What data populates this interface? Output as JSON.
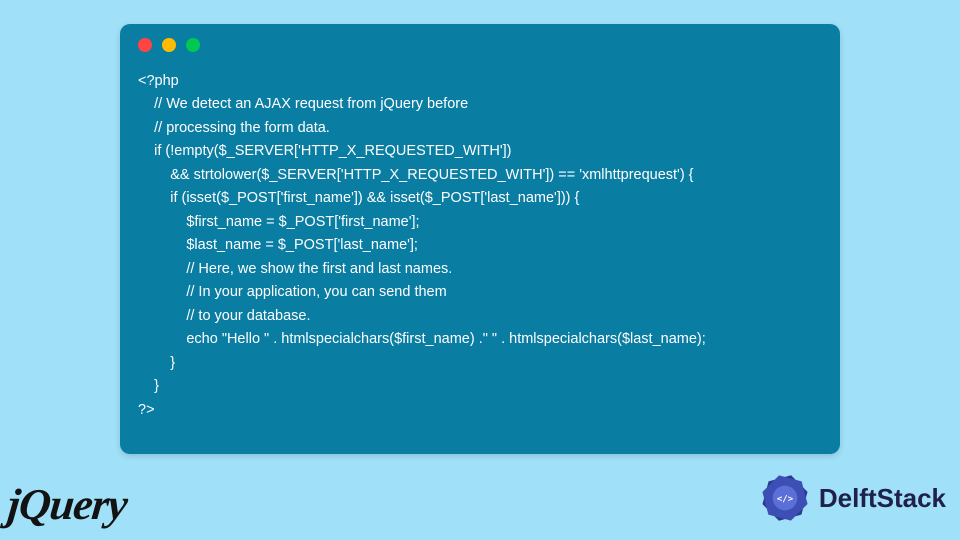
{
  "code_lines": [
    "<?php",
    "    // We detect an AJAX request from jQuery before",
    "    // processing the form data.",
    "    if (!empty($_SERVER['HTTP_X_REQUESTED_WITH'])",
    "        && strtolower($_SERVER['HTTP_X_REQUESTED_WITH']) == 'xmlhttprequest') {",
    "        if (isset($_POST['first_name']) && isset($_POST['last_name'])) {",
    "            $first_name = $_POST['first_name'];",
    "            $last_name = $_POST['last_name'];",
    "            // Here, we show the first and last names.",
    "            // In your application, you can send them",
    "            // to your database.",
    "            echo \"Hello \" . htmlspecialchars($first_name) .\" \" . htmlspecialchars($last_name);",
    "        }",
    "    }",
    "?>"
  ],
  "logos": {
    "jquery": "jQuery",
    "delft": "DelftStack"
  },
  "window": {
    "dots": [
      "red",
      "yellow",
      "green"
    ]
  }
}
